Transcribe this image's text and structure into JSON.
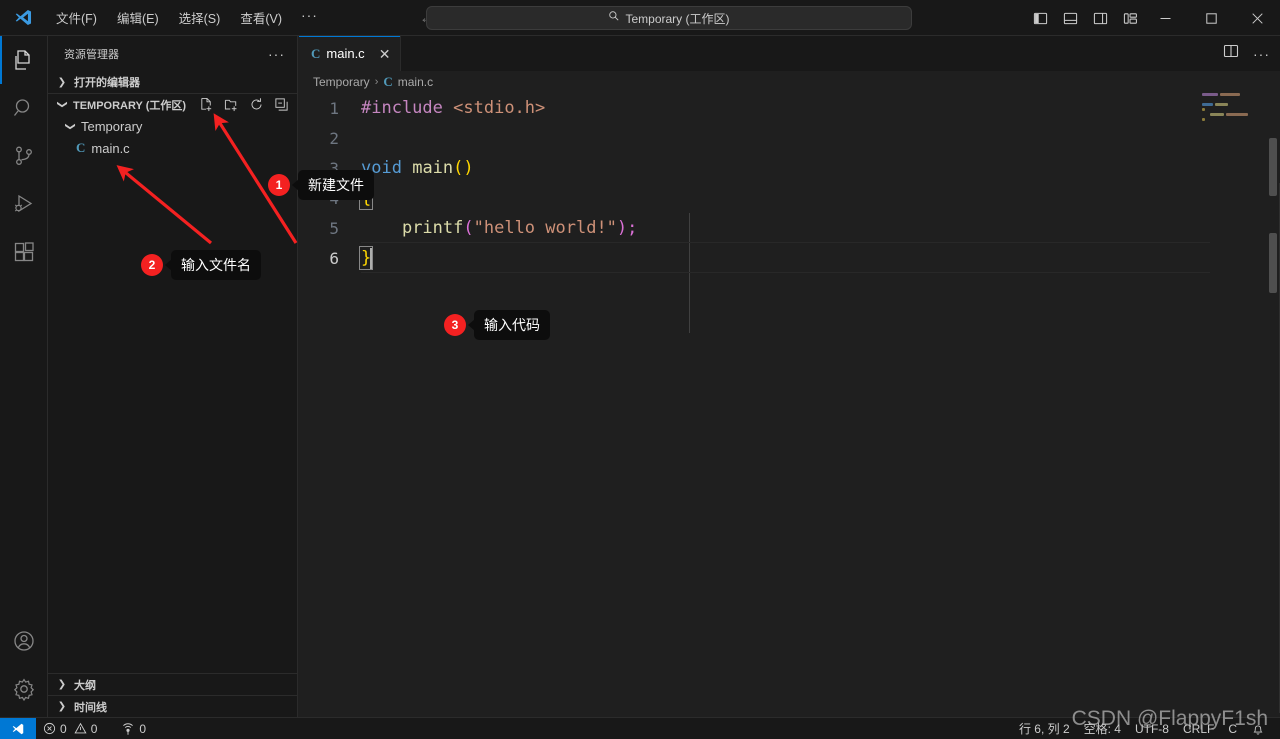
{
  "titlebar": {
    "logo_icon": "vscode-logo-icon",
    "menus": [
      {
        "label": "文件(F)",
        "name": "menu-file"
      },
      {
        "label": "编辑(E)",
        "name": "menu-edit"
      },
      {
        "label": "选择(S)",
        "name": "menu-selection"
      },
      {
        "label": "查看(V)",
        "name": "menu-view"
      },
      {
        "label": "···",
        "name": "menu-more"
      }
    ],
    "nav_back_icon": "arrow-left-icon",
    "nav_forward_icon": "arrow-right-icon",
    "search": {
      "value": "Temporary (工作区)",
      "icon": "search-icon"
    },
    "layout_icons": [
      {
        "name": "toggle-primary-sidebar-icon"
      },
      {
        "name": "toggle-panel-icon"
      },
      {
        "name": "toggle-secondary-sidebar-icon"
      },
      {
        "name": "customize-layout-icon"
      }
    ],
    "window_controls": {
      "minimize": "─",
      "maximize": "▢",
      "close": "✕"
    }
  },
  "activitybar": {
    "items": [
      {
        "name": "activity-explorer",
        "icon": "files-icon",
        "active": true
      },
      {
        "name": "activity-search",
        "icon": "search-icon",
        "active": false
      },
      {
        "name": "activity-source-control",
        "icon": "source-control-icon",
        "active": false
      },
      {
        "name": "activity-run-debug",
        "icon": "run-and-debug-icon",
        "active": false
      },
      {
        "name": "activity-extensions",
        "icon": "extensions-icon",
        "active": false
      }
    ],
    "bottom_items": [
      {
        "name": "activity-account",
        "icon": "account-icon"
      },
      {
        "name": "activity-settings",
        "icon": "gear-icon"
      }
    ]
  },
  "sidebar": {
    "title": "资源管理器",
    "more_actions": "···",
    "open_editors_label": "打开的编辑器",
    "workspace_label": "TEMPORARY (工作区)",
    "workspace_actions": [
      {
        "name": "new-file-icon",
        "label": "新建文件"
      },
      {
        "name": "new-folder-icon",
        "label": "新建文件夹"
      },
      {
        "name": "refresh-icon",
        "label": "刷新"
      },
      {
        "name": "collapse-all-icon",
        "label": "折叠"
      }
    ],
    "tree": [
      {
        "name": "tree-folder-temporary",
        "label": "Temporary",
        "type": "folder",
        "expanded": true
      },
      {
        "name": "tree-file-main-c",
        "label": "main.c",
        "type": "file",
        "badge": "C"
      }
    ],
    "bottom_sections": [
      {
        "name": "sidebar-section-outline",
        "label": "大纲"
      },
      {
        "name": "sidebar-section-timeline",
        "label": "时间线"
      }
    ]
  },
  "editor": {
    "tab": {
      "label": "main.c",
      "badge": "C",
      "close_icon": "close-icon"
    },
    "tab_actions": [
      {
        "name": "split-editor-icon"
      },
      {
        "name": "editor-more-actions",
        "label": "···"
      }
    ],
    "breadcrumb": {
      "folder": "Temporary",
      "separator": "›",
      "file": "main.c",
      "file_badge": "C"
    },
    "lines": [
      {
        "number": "1",
        "text": "#include <stdio.h>"
      },
      {
        "number": "2",
        "text": ""
      },
      {
        "number": "3",
        "text": "void main()"
      },
      {
        "number": "4",
        "text": "{"
      },
      {
        "number": "5",
        "text": "    printf(\"hello world!\");"
      },
      {
        "number": "6",
        "text": "}"
      }
    ],
    "code": {
      "l1_include": "#include",
      "l1_header": "<stdio.h>",
      "l3_type": "void",
      "l3_fn": "main",
      "l3_parens": "()",
      "l4_brace": "{",
      "l5_fn": "printf",
      "l5_open": "(",
      "l5_str": "\"hello world!\"",
      "l5_close": ")",
      "l5_semi": ";",
      "l6_brace": "}"
    },
    "active_line": "6"
  },
  "statusbar": {
    "remote_icon": "remote-window-icon",
    "left_items": [
      {
        "name": "status-errors",
        "icon": "error-icon",
        "value": "0"
      },
      {
        "name": "status-warnings",
        "icon": "warning-icon",
        "value": "0"
      },
      {
        "name": "status-ports",
        "icon": "ports-icon",
        "value": "0"
      }
    ],
    "right_items": [
      {
        "name": "status-cursor-position",
        "label": "行 6, 列 2"
      },
      {
        "name": "status-indentation",
        "label": "空格: 4"
      },
      {
        "name": "status-encoding",
        "label": "UTF-8"
      },
      {
        "name": "status-eol",
        "label": "CRLF"
      },
      {
        "name": "status-language-mode",
        "label": "C"
      },
      {
        "name": "status-notifications",
        "label": "",
        "icon": "bell-icon"
      }
    ]
  },
  "annotations": [
    {
      "name": "annotation-1",
      "number": "1",
      "label": "新建文件"
    },
    {
      "name": "annotation-2",
      "number": "2",
      "label": "输入文件名"
    },
    {
      "name": "annotation-3",
      "number": "3",
      "label": "输入代码"
    }
  ],
  "watermark": "CSDN @FlappyF1sh",
  "colors": {
    "accent": "#0078d4",
    "annotation_red": "#f42121",
    "editor_bg": "#1f1f1f",
    "chrome_bg": "#181818"
  }
}
